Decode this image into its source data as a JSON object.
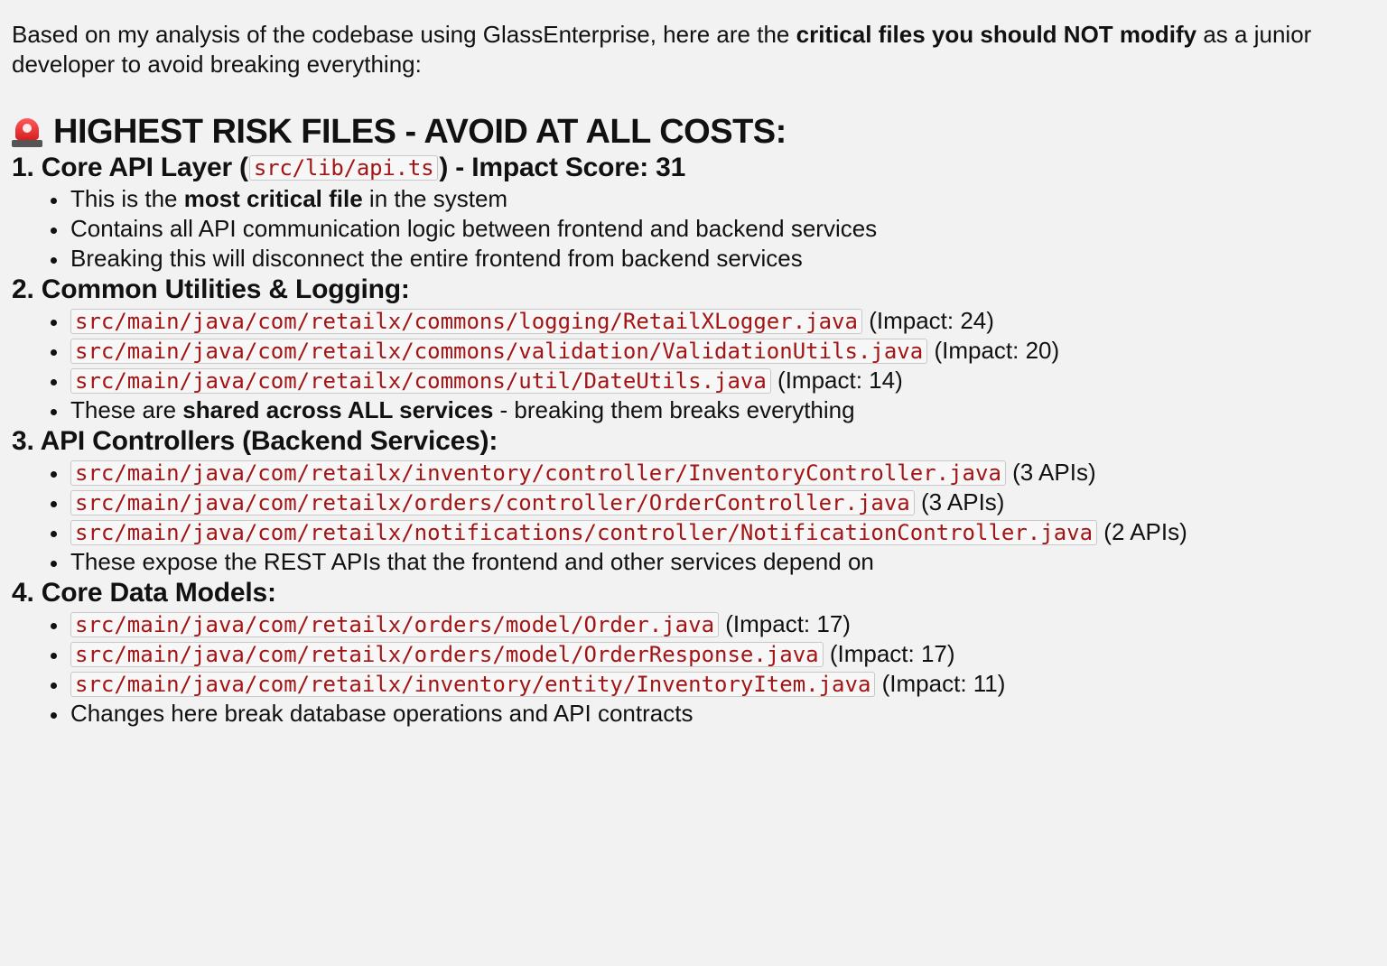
{
  "intro": {
    "part1": "Based on my analysis of the codebase using GlassEnterprise, here are the ",
    "bold": "critical files you should NOT modify",
    "part2": " as a junior developer to avoid breaking everything:"
  },
  "risk_heading": {
    "icon": "siren-icon",
    "text": "HIGHEST RISK FILES - AVOID AT ALL COSTS:"
  },
  "sections": [
    {
      "heading_pre": "1. Core API Layer (",
      "heading_code": "src/lib/api.ts",
      "heading_post": ") - Impact Score: 31",
      "bullets": [
        {
          "pre": "This is the ",
          "bold": "most critical file",
          "post": " in the system"
        },
        {
          "text": "Contains all API communication logic between frontend and backend services"
        },
        {
          "text": "Breaking this will disconnect the entire frontend from backend services"
        }
      ]
    },
    {
      "heading": "2. Common Utilities & Logging:",
      "bullets": [
        {
          "code": "src/main/java/com/retailx/commons/logging/RetailXLogger.java",
          "note": "(Impact: 24)"
        },
        {
          "code": "src/main/java/com/retailx/commons/validation/ValidationUtils.java",
          "note": "(Impact: 20)"
        },
        {
          "code": "src/main/java/com/retailx/commons/util/DateUtils.java",
          "note": "(Impact: 14)"
        },
        {
          "pre": "These are ",
          "bold": "shared across ALL services",
          "post": " - breaking them breaks everything"
        }
      ]
    },
    {
      "heading": "3. API Controllers (Backend Services):",
      "bullets": [
        {
          "code": "src/main/java/com/retailx/inventory/controller/InventoryController.java",
          "note": "(3 APIs)"
        },
        {
          "code": "src/main/java/com/retailx/orders/controller/OrderController.java",
          "note": "(3 APIs)"
        },
        {
          "code": "src/main/java/com/retailx/notifications/controller/NotificationController.java",
          "note": "(2 APIs)"
        },
        {
          "text": "These expose the REST APIs that the frontend and other services depend on"
        }
      ]
    },
    {
      "heading": "4. Core Data Models:",
      "bullets": [
        {
          "code": "src/main/java/com/retailx/orders/model/Order.java",
          "note": "(Impact: 17)"
        },
        {
          "code": "src/main/java/com/retailx/orders/model/OrderResponse.java",
          "note": "(Impact: 17)"
        },
        {
          "code": "src/main/java/com/retailx/inventory/entity/InventoryItem.java",
          "note": "(Impact: 11)"
        },
        {
          "text": "Changes here break database operations and API contracts"
        }
      ]
    }
  ]
}
